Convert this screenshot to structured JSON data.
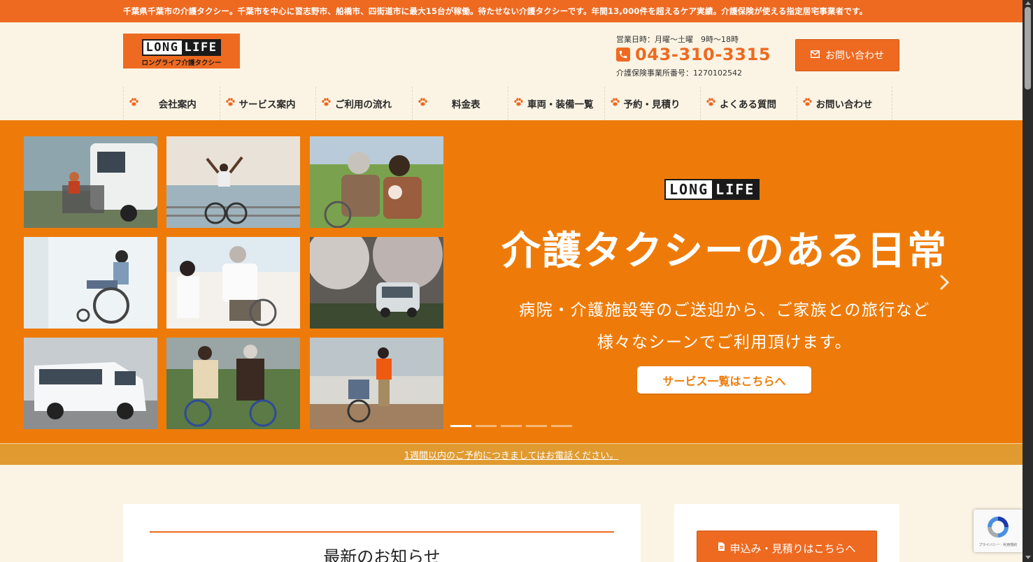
{
  "topbar": {
    "text": "千葉県千葉市の介護タクシー。千葉市を中心に習志野市、船橋市、四街道市に最大15台が稼働。待たせない介護タクシーです。年間13,000件を超えるケア実績。介護保険が使える指定居宅事業者です。"
  },
  "header": {
    "logo_left": "LONG",
    "logo_right": "LIFE",
    "logo_sub": "ロングライフ介護タクシー",
    "hours": "営業日時：月曜～土曜　9時～18時",
    "phone": "043-310-3315",
    "license": "介護保険事業所番号：1270102542",
    "contact_label": "お問い合わせ",
    "accent_color": "#ee6a21"
  },
  "nav": {
    "items": [
      {
        "label": "会社案内"
      },
      {
        "label": "サービス案内"
      },
      {
        "label": "ご利用の流れ"
      },
      {
        "label": "料金表"
      },
      {
        "label": "車両・装備一覧"
      },
      {
        "label": "予約・見積り"
      },
      {
        "label": "よくある質問"
      },
      {
        "label": "お問い合わせ"
      }
    ]
  },
  "hero": {
    "logo_left": "LONG",
    "logo_right": "LIFE",
    "title": "介護タクシーのある日常",
    "subtitle_1": "病院・介護施設等のご送迎から、ご家族との旅行など",
    "subtitle_2": "様々なシーンでご利用頂けます。",
    "button_label": "サービス一覧はこちらへ",
    "background_color": "#ee7b09",
    "slide_count": 5,
    "active_slide": 1
  },
  "notice": {
    "text": "1週間以内のご予約につきましてはお電話ください。"
  },
  "main": {
    "heading": "最新のお知らせ"
  },
  "sidebar": {
    "apply_label": "申込み・見積りはこちらへ"
  },
  "recaptcha": {
    "fine_print": "プライバシー - 利用規約"
  },
  "icons": {
    "phone": "phone-icon",
    "mail": "envelope-icon",
    "paw": "paw-icon",
    "document": "document-icon",
    "next": "chevron-right-icon"
  }
}
